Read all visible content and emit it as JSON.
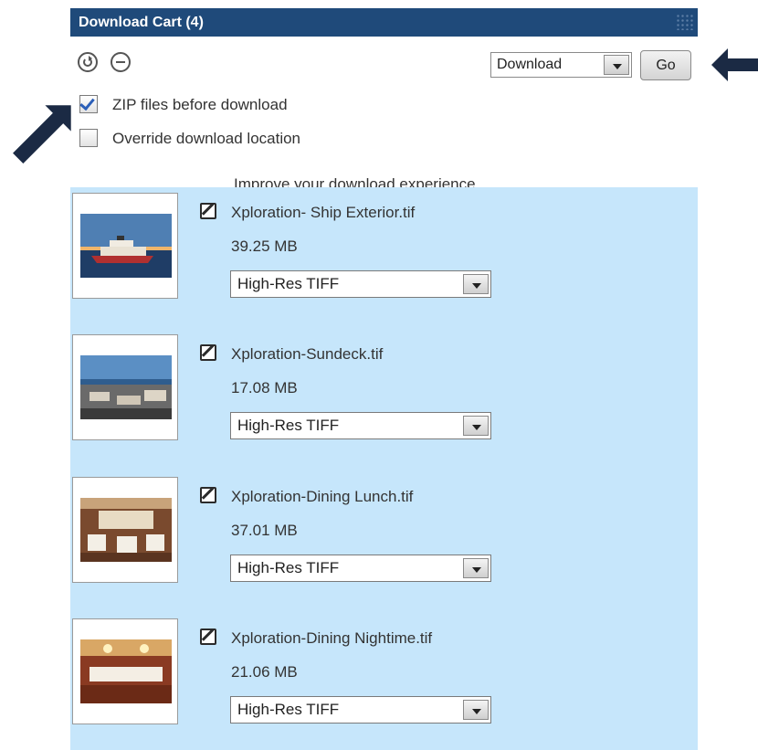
{
  "header": {
    "title": "Download Cart (4)"
  },
  "toolbar": {
    "action_select_value": "Download",
    "go_label": "Go"
  },
  "options": {
    "zip_label": "ZIP files before download",
    "zip_checked": true,
    "override_label": "Override download location",
    "override_checked": false
  },
  "improve_text": "Improve your download experience",
  "items": [
    {
      "name": "Xploration- Ship Exterior.tif",
      "size": "39.25 MB",
      "format": "High-Res TIFF"
    },
    {
      "name": "Xploration-Sundeck.tif",
      "size": "17.08 MB",
      "format": "High-Res TIFF"
    },
    {
      "name": "Xploration-Dining Lunch.tif",
      "size": "37.01 MB",
      "format": "High-Res TIFF"
    },
    {
      "name": "Xploration-Dining Nightime.tif",
      "size": "21.06 MB",
      "format": "High-Res TIFF"
    }
  ],
  "icons": {
    "restore": "restore-icon",
    "remove": "remove-icon",
    "edit": "edit-icon",
    "dropdown": "chevron-down-icon"
  },
  "colors": {
    "header_bg": "#1f4a7a",
    "panel_bg": "#c6e6fb",
    "arrow": "#1b2a44"
  }
}
